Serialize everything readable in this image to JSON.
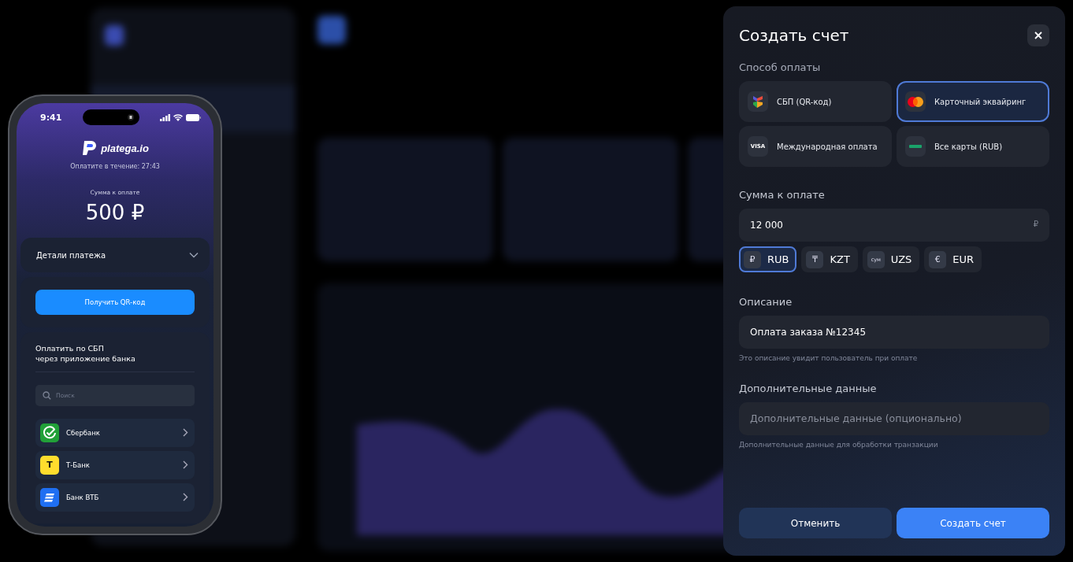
{
  "phone": {
    "status_time": "9:41",
    "logo": "platega.io",
    "timer_text": "Оплатите в течение: 27:43",
    "amount_label": "Сумма к оплате",
    "amount": "500 ₽",
    "details": {
      "label": "Детали платежа",
      "expanded": false
    },
    "qr_button": "Получить QR-код",
    "sbp_title": "Оплатить по СБП\nчерез приложение банка",
    "search": {
      "placeholder": "Поиск"
    },
    "banks": [
      {
        "name": "Сбербанк",
        "kind": "check",
        "color": "#21a038"
      },
      {
        "name": "Т-Банк",
        "kind": "letter",
        "icon_text": "Т",
        "color": "#ffdd2d"
      },
      {
        "name": "Банк ВТБ",
        "kind": "stripes",
        "color": "#1f6ff2"
      }
    ]
  },
  "modal": {
    "title": "Создать счет",
    "payment_method": {
      "label": "Способ оплаты",
      "options": [
        {
          "label": "СБП (QR-код)",
          "kind": "pinwheel",
          "selected": false
        },
        {
          "label": "Карточный эквайринг",
          "kind": "circles",
          "selected": true
        },
        {
          "label": "Международная оплата",
          "kind": "text",
          "icon_text": "VISA",
          "selected": false
        },
        {
          "label": "Все карты (RUB)",
          "kind": "bar",
          "selected": false
        }
      ]
    },
    "amount": {
      "label": "Сумма к оплате",
      "value": "12 000",
      "suffix": "₽"
    },
    "currencies": [
      {
        "symbol": "₽",
        "code": "RUB",
        "selected": true
      },
      {
        "symbol": "₸",
        "code": "KZT",
        "selected": false
      },
      {
        "symbol": "сум",
        "code": "UZS",
        "selected": false
      },
      {
        "symbol": "€",
        "code": "EUR",
        "selected": false
      }
    ],
    "description": {
      "label": "Описание",
      "value": "Оплата заказа №12345",
      "hint": "Это описание увидит пользователь при оплате"
    },
    "extra": {
      "label": "Дополнительные данные",
      "placeholder": "Дополнительные данные (опционально)",
      "hint": "Дополнительные данные для обработки транзакции"
    },
    "buttons": [
      {
        "label": "Отменить",
        "kind": "secondary"
      },
      {
        "label": "Создать счет",
        "kind": "primary"
      }
    ]
  }
}
